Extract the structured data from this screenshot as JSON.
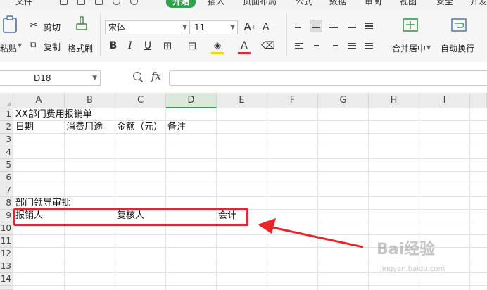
{
  "menu": {
    "items": [
      {
        "label": "文件"
      },
      {
        "label": "开始"
      },
      {
        "label": "插入"
      },
      {
        "label": "页面布局"
      },
      {
        "label": "公式"
      },
      {
        "label": "数据"
      },
      {
        "label": "审阅"
      },
      {
        "label": "视图"
      },
      {
        "label": "安全"
      },
      {
        "label": "开发"
      }
    ]
  },
  "ribbon": {
    "paste": "粘贴",
    "cut": "剪切",
    "copy": "复制",
    "format_painter": "格式刷",
    "font_name": "宋体",
    "font_size": "11",
    "merge_center": "合并居中",
    "wrap_text": "自动换行"
  },
  "formula_bar": {
    "cell_ref": "D18",
    "fx": "fx",
    "content": ""
  },
  "columns": [
    "A",
    "B",
    "C",
    "D",
    "E",
    "F",
    "G",
    "H",
    "I"
  ],
  "selected_column": "D",
  "rows": [
    "1",
    "2",
    "3",
    "4",
    "5",
    "6",
    "7",
    "8",
    "9",
    "10",
    "11",
    "12",
    "13",
    "14"
  ],
  "cells": {
    "a1": "XX部门费用报销单",
    "a2": "日期",
    "b2": "消费用途",
    "c2": "金额（元）",
    "d2": "备注",
    "a8": "部门领导审批",
    "a9": "报销人",
    "c9": "复核人",
    "e9": "会计"
  },
  "watermark": {
    "brand": "Bai经验",
    "url": "jingyan.baidu.com"
  },
  "colors": {
    "accent": "#2ca24b",
    "highlight": "#e8262a"
  }
}
